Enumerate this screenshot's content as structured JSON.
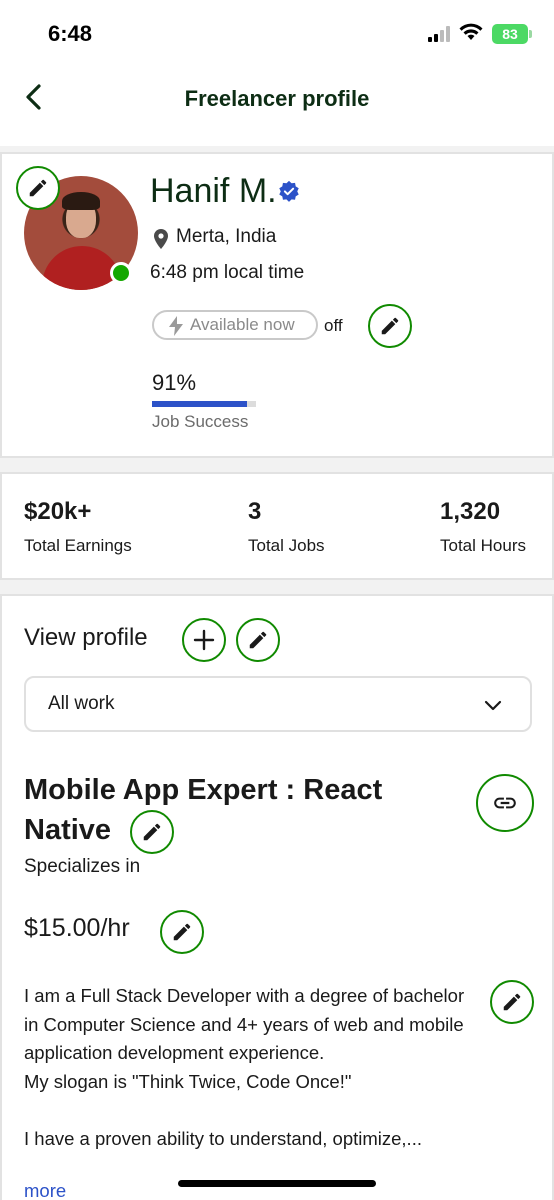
{
  "status_bar": {
    "time": "6:48",
    "battery": "83"
  },
  "nav": {
    "title": "Freelancer profile"
  },
  "profile": {
    "name": "Hanif M.",
    "location": "Merta, India",
    "local_time": "6:48 pm local time",
    "availability": "Available now",
    "availability_state": "off",
    "job_success_value": "91%",
    "job_success_fraction": 0.91,
    "job_success_label": "Job Success"
  },
  "stats": [
    {
      "value": "$20k+",
      "label": "Total Earnings"
    },
    {
      "value": "3",
      "label": "Total Jobs"
    },
    {
      "value": "1,320",
      "label": "Total Hours"
    }
  ],
  "view_profile": {
    "title": "View profile",
    "select_value": "All work",
    "job_title": "Mobile App Expert : React Native",
    "specializes": "Specializes in",
    "rate": "$15.00/hr",
    "bio": "I am a Full Stack Developer with a degree of bachelor in Computer Science and 4+ years of web and mobile application development experience.\nMy slogan is \"Think Twice, Code Once!\"\n\nI have a proven ability to understand, optimize,...",
    "more_link": "more"
  },
  "colors": {
    "accent_green": "#108a00",
    "online_green": "#14a800",
    "link_blue": "#2c52c8"
  }
}
